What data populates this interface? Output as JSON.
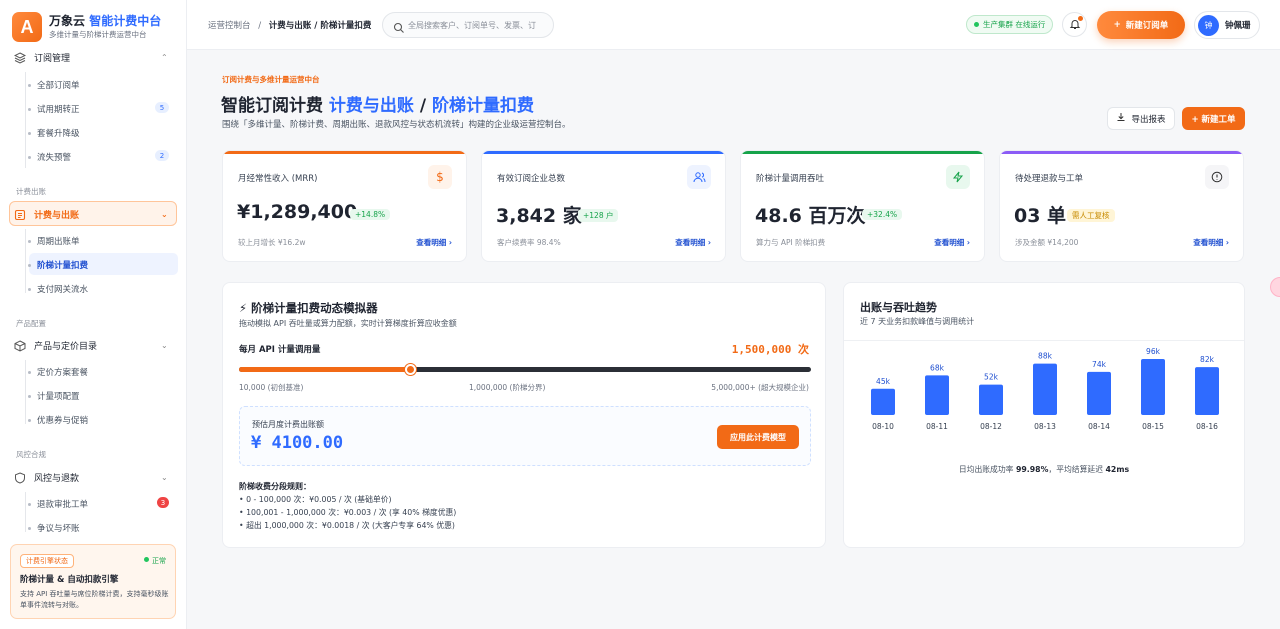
{
  "brand": {
    "logo": "A",
    "name": "万象云",
    "name_highlight": "智能计费中台",
    "subtitle": "多维计量与阶梯计费运营中台"
  },
  "sidebar": {
    "groups": [
      {
        "label": "订阅管理",
        "icon": "layers-icon",
        "items": [
          {
            "label": "全部订阅单"
          },
          {
            "label": "试用期转正",
            "badge": "5"
          },
          {
            "label": "套餐升降级"
          },
          {
            "label": "流失预警",
            "badge": "2"
          }
        ]
      },
      {
        "section": "计费出账",
        "label": "计费与出账",
        "icon": "receipt-icon",
        "items": [
          {
            "label": "周期出账单"
          },
          {
            "label": "阶梯计量扣费"
          },
          {
            "label": "支付网关流水"
          }
        ]
      },
      {
        "section": "产品配置",
        "label": "产品与定价目录",
        "icon": "box-icon",
        "items": [
          {
            "label": "定价方案套餐"
          },
          {
            "label": "计量项配置"
          },
          {
            "label": "优惠券与促销"
          }
        ]
      },
      {
        "section": "风控合规",
        "label": "风控与退款",
        "icon": "shield-icon",
        "items": [
          {
            "label": "退款审批工单",
            "badge": "3"
          },
          {
            "label": "争议与坏账"
          }
        ]
      }
    ],
    "engine": {
      "tag": "计费引擎状态",
      "status": "正常",
      "title": "阶梯计量 & 自动扣款引擎",
      "desc": "支持 API 吞吐量与席位阶梯计费，支持毫秒级账单事件流转与对账。"
    }
  },
  "topbar": {
    "breadcrumb_root": "运营控制台",
    "breadcrumb_sep": "/",
    "breadcrumb_current": "计费与出账 / 阶梯计量扣费",
    "search_placeholder": "全局搜索客户、订阅单号、发票、订",
    "env_status": "生产集群 在线运行",
    "new_button": "新建订阅单",
    "user_initial": "钟",
    "user_name": "钟佩珊"
  },
  "header": {
    "eyebrow": "订阅计费与多维计量运营中台",
    "title_a": "智能订阅计费",
    "title_b": "计费与出账",
    "title_sep": "/",
    "title_c": "阶梯计量扣费",
    "desc": "围绕「多维计量、阶梯计费、周期出账、退款风控与状态机流转」构建的企业级运营控制台。",
    "export_label": "导出报表",
    "ticket_label": "+ 新建工单"
  },
  "kpis": [
    {
      "label": "月经常性收入 (MRR)",
      "value": "¥1,289,400",
      "chip": "+14.8%",
      "foot": "较上月增长 ¥16.2w",
      "more": "查看明细 ›",
      "color": "#f26a16",
      "icon": "dollar-icon"
    },
    {
      "label": "有效订阅企业总数",
      "value": "3,842 家",
      "chip": "+128 户",
      "foot": "客户续费率 98.4%",
      "more": "查看明细 ›",
      "color": "#2f6bff",
      "icon": "users-icon"
    },
    {
      "label": "阶梯计量调用吞吐",
      "value": "48.6 百万次",
      "chip": "+32.4%",
      "foot": "算力与 API 阶梯扣费",
      "more": "查看明细 ›",
      "color": "#16a34a",
      "icon": "bolt-icon"
    },
    {
      "label": "待处理退款与工单",
      "value": "03 单",
      "chip": "需人工复核",
      "foot": "涉及金额 ¥14,200",
      "more": "查看明细 ›",
      "color": "#8b5cf6",
      "icon": "alert-icon"
    }
  ],
  "simulator": {
    "title": "⚡ 阶梯计量扣费动态模拟器",
    "subtitle": "拖动模拟 API 吞吐量或算力配额，实时计算梯度折算应收金额",
    "slider_label": "每月 API 计量调用量",
    "slider_value": "1,500,000 次",
    "slider_fraction": 0.3,
    "tick_min": "10,000 (初创基准)",
    "tick_mid": "1,000,000 (阶梯分界)",
    "tick_max": "5,000,000+ (超大规模企业)",
    "estimate_label": "预估月度计费出账额",
    "estimate_value": "¥ 4100.00",
    "apply_label": "应用此计费模型",
    "rules_title": "阶梯收费分段规则：",
    "rules": [
      "• 0 - 100,000 次：¥0.005 / 次 (基础单价)",
      "• 100,001 - 1,000,000 次：¥0.003 / 次 (享 40% 梯度优惠)",
      "• 超出 1,000,000 次：¥0.0018 / 次 (大客户专享 64% 优惠)"
    ]
  },
  "trend": {
    "title": "出账与吞吐趋势",
    "subtitle": "近 7 天业务扣款峰值与调用统计",
    "footer_a": "日均出账成功率 ",
    "footer_b": "99.98%",
    "footer_c": "，平均结算延迟 ",
    "footer_d": "42ms"
  },
  "chart_data": {
    "type": "bar",
    "categories": [
      "08-10",
      "08-11",
      "08-12",
      "08-13",
      "08-14",
      "08-15",
      "08-16"
    ],
    "values": [
      45,
      68,
      52,
      88,
      74,
      96,
      82
    ],
    "labels": [
      "45k",
      "68k",
      "52k",
      "88k",
      "74k",
      "96k",
      "82k"
    ],
    "color": "#2f6bff"
  }
}
